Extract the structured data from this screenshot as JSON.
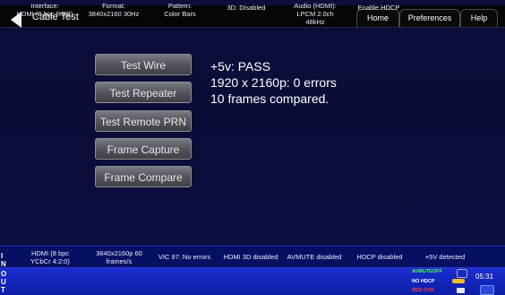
{
  "header": {
    "title": "Cable Test",
    "tabs": [
      {
        "label": "Home"
      },
      {
        "label": "Preferences"
      },
      {
        "label": "Help"
      }
    ]
  },
  "actions": [
    {
      "label": "Test Wire"
    },
    {
      "label": "Test Repeater"
    },
    {
      "label": "Test Remote PRN"
    },
    {
      "label": "Frame Capture"
    },
    {
      "label": "Frame Compare"
    }
  ],
  "results": {
    "line1": "+5v: PASS",
    "line2": "1920 x 2160p: 0 errors",
    "line3": "10 frames compared."
  },
  "status": {
    "side_letters": [
      "I",
      "N"
    ],
    "cells": [
      {
        "line1": "HDMI (8 bpc",
        "line2": "YCbCr 4:2:0)"
      },
      {
        "line1": "3840x2160p 60",
        "line2": "frames/s"
      },
      {
        "line1": "VIC 97: No errors",
        "line2": ""
      },
      {
        "line1": "HDMI 3D disabled",
        "line2": ""
      },
      {
        "line1": "AVMUTE disabled",
        "line2": ""
      },
      {
        "line1": "HDCP disabled",
        "line2": ""
      },
      {
        "line1": "+5V detected",
        "line2": ""
      }
    ]
  },
  "controls": {
    "side_letters": [
      "O",
      "U",
      "T"
    ],
    "items": [
      {
        "line1": "Interface:",
        "line2": "HDMI (8 bpc RGB)",
        "line3": ""
      },
      {
        "line1": "Format:",
        "line2": "3840x2160 30Hz",
        "line3": ""
      },
      {
        "line1": "Pattern:",
        "line2": "Color Bars",
        "line3": ""
      },
      {
        "line1": "3D: Disabled",
        "line2": "",
        "line3": ""
      },
      {
        "line1": "Audio (HDMI):",
        "line2": "LPCM 2.0ch",
        "line3": "48kHz"
      },
      {
        "line1": "Enable HDCP",
        "line2": "",
        "line3": ""
      }
    ],
    "badges": {
      "avmute": "AVMUTEOFF",
      "hdcp": "NO HDCP",
      "red": "RED CHK"
    },
    "time": "05:31"
  }
}
